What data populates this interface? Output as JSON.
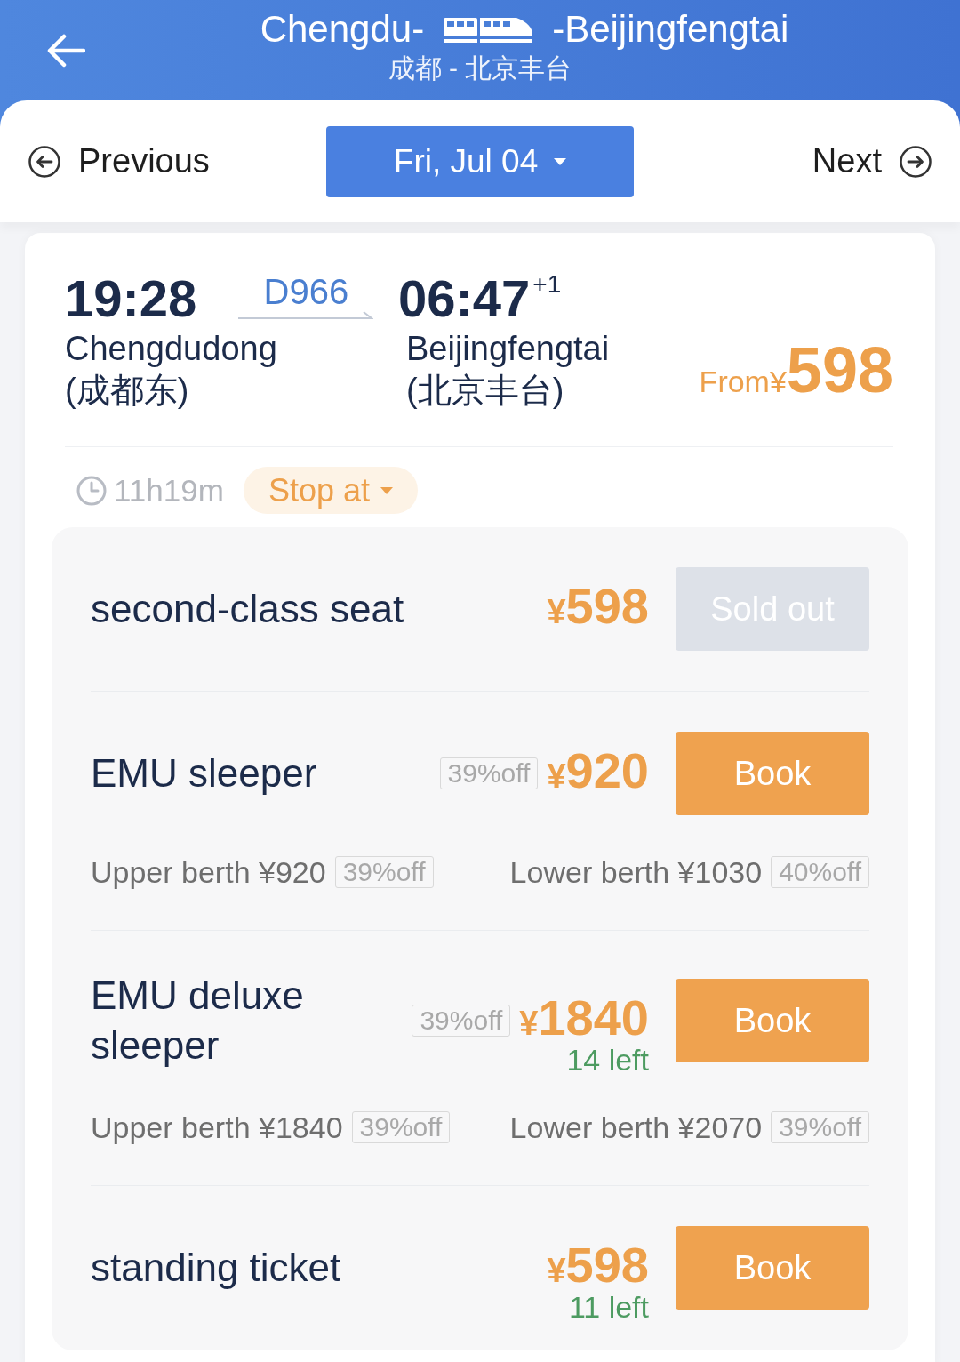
{
  "header": {
    "title_from": "Chengdu-",
    "title_to": "-Beijingfengtai",
    "subtitle": "成都 - 北京丰台"
  },
  "date_nav": {
    "previous": "Previous",
    "date": "Fri, Jul 04",
    "next": "Next"
  },
  "train": {
    "departure": {
      "time": "19:28",
      "station": "Chengdudong",
      "station_local": "(成都东)"
    },
    "number": "D966",
    "arrival": {
      "time": "06:47",
      "day_offset": "+1",
      "station": "Beijingfengtai",
      "station_local": "(北京丰台)"
    },
    "lowest_price": {
      "label": "From",
      "currency": "¥",
      "amount": "598"
    },
    "duration": "11h19m",
    "stops_button": "Stop at"
  },
  "seats": [
    {
      "name": "second-class seat",
      "currency": "¥",
      "price": "598",
      "button": {
        "label": "Sold out",
        "disabled": true
      }
    },
    {
      "name": "EMU sleeper",
      "discount": "39%off",
      "currency": "¥",
      "price": "920",
      "button": {
        "label": "Book",
        "disabled": false
      },
      "berths": [
        {
          "text": "Upper berth ¥920",
          "discount": "39%off"
        },
        {
          "text": "Lower berth ¥1030",
          "discount": "40%off"
        }
      ]
    },
    {
      "name": "EMU deluxe sleeper",
      "discount": "39%off",
      "currency": "¥",
      "price": "1840",
      "remaining": "14 left",
      "button": {
        "label": "Book",
        "disabled": false
      },
      "berths": [
        {
          "text": "Upper berth ¥1840",
          "discount": "39%off"
        },
        {
          "text": "Lower berth ¥2070",
          "discount": "39%off"
        }
      ]
    },
    {
      "name": "standing ticket",
      "currency": "¥",
      "price": "598",
      "remaining": "11 left",
      "button": {
        "label": "Book",
        "disabled": false
      }
    }
  ]
}
